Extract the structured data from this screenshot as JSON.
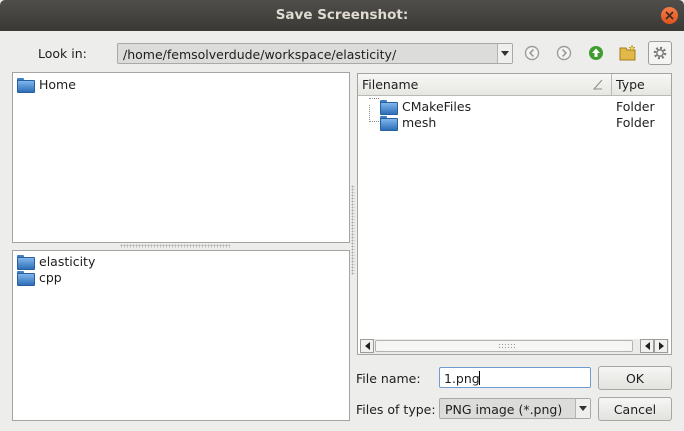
{
  "window": {
    "title": "Save Screenshot:"
  },
  "toolbar": {
    "look_in_label": "Look in:",
    "path": "/home/femsolverdude/workspace/elasticity/",
    "icons": [
      "back-icon",
      "forward-icon",
      "up-icon",
      "new-folder-icon",
      "gear-icon"
    ]
  },
  "sidebar": {
    "places": [
      {
        "label": "Home"
      }
    ],
    "recent": [
      {
        "label": "elasticity"
      },
      {
        "label": "cpp"
      }
    ]
  },
  "file_list": {
    "columns": {
      "name": "Filename",
      "type": "Type"
    },
    "rows": [
      {
        "name": "CMakeFiles",
        "type": "Folder"
      },
      {
        "name": "mesh",
        "type": "Folder"
      }
    ]
  },
  "form": {
    "file_name_label": "File name:",
    "file_name_value": "1.png",
    "file_type_label": "Files of type:",
    "file_type_value": "PNG image (*.png)"
  },
  "buttons": {
    "ok": "OK",
    "cancel": "Cancel"
  },
  "colors": {
    "accent": "#3f9d2f",
    "folder": "#3f7fc4",
    "close": "#e0531d"
  }
}
